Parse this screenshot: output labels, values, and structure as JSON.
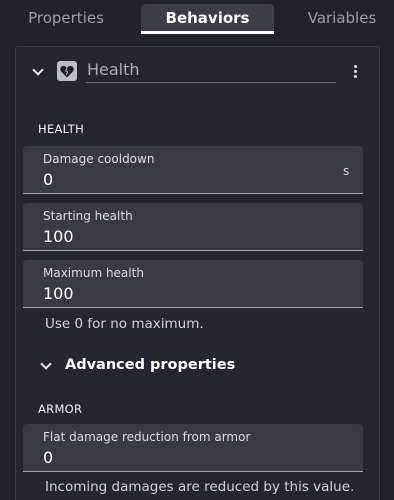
{
  "tabs": [
    {
      "label": "Properties"
    },
    {
      "label": "Behaviors"
    },
    {
      "label": "Variables"
    }
  ],
  "behavior": {
    "name": "Health",
    "icon": "heart-icon",
    "section": "HEALTH",
    "fields": [
      {
        "label": "Damage cooldown",
        "value": "0",
        "unit": "s"
      },
      {
        "label": "Starting health",
        "value": "100"
      },
      {
        "label": "Maximum health",
        "value": "100",
        "helper": "Use 0 for no maximum."
      }
    ],
    "advanced": {
      "title": "Advanced properties",
      "section": "ARMOR",
      "fields": [
        {
          "label": "Flat damage reduction from armor",
          "value": "0",
          "helper": "Incoming damages are reduced by this value."
        }
      ]
    }
  },
  "colors": {
    "background": "#222229",
    "active_tab": "#3d3d46",
    "field_bg": "#3a3a43"
  }
}
